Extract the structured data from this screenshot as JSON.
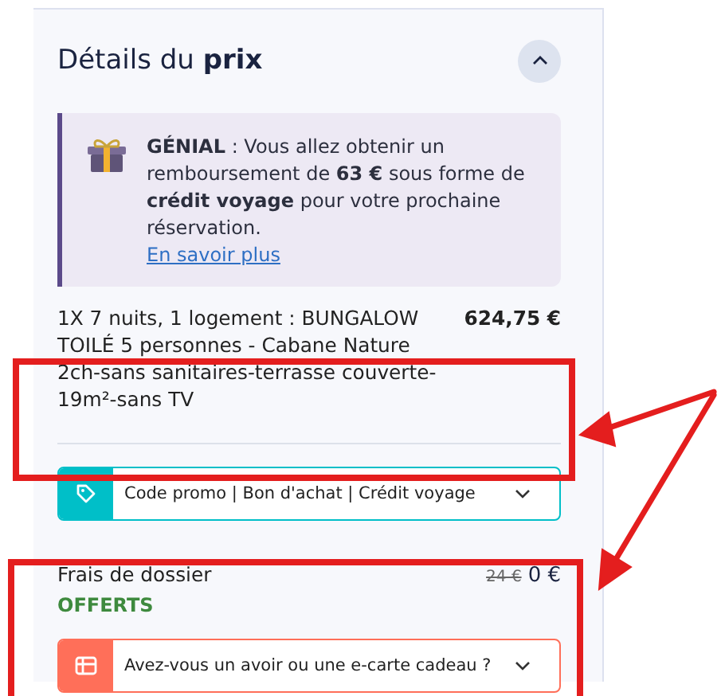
{
  "panel": {
    "title": "Détails du **prix**",
    "expanded": true
  },
  "info": {
    "text": "**GÉNIAL** : Vous allez obtenir un remboursement de **63 €** sous forme de **crédit voyage** pour votre prochaine réservation.",
    "link": "En savoir plus"
  },
  "line_item": {
    "description": "1X 7 nuits, 1 logement : BUNGALOW TOILÉ 5 personnes - Cabane Nature 2ch-sans sanitaires-terrasse couverte-19m²-sans TV",
    "price": "624,75 €"
  },
  "dropdowns": [
    {
      "kind": "promo",
      "label": "Code promo | Bon d'achat | Crédit voyage",
      "color": "#00bfc8",
      "expanded": false
    },
    {
      "kind": "giftcard",
      "label": "Avez-vous un avoir ou une e-carte cadeau ?",
      "color": "#ff6f59",
      "expanded": false
    }
  ],
  "fees": {
    "label": "Frais de dossier",
    "old_price": "24 €",
    "price": "0 €",
    "note": "OFFERTS"
  }
}
